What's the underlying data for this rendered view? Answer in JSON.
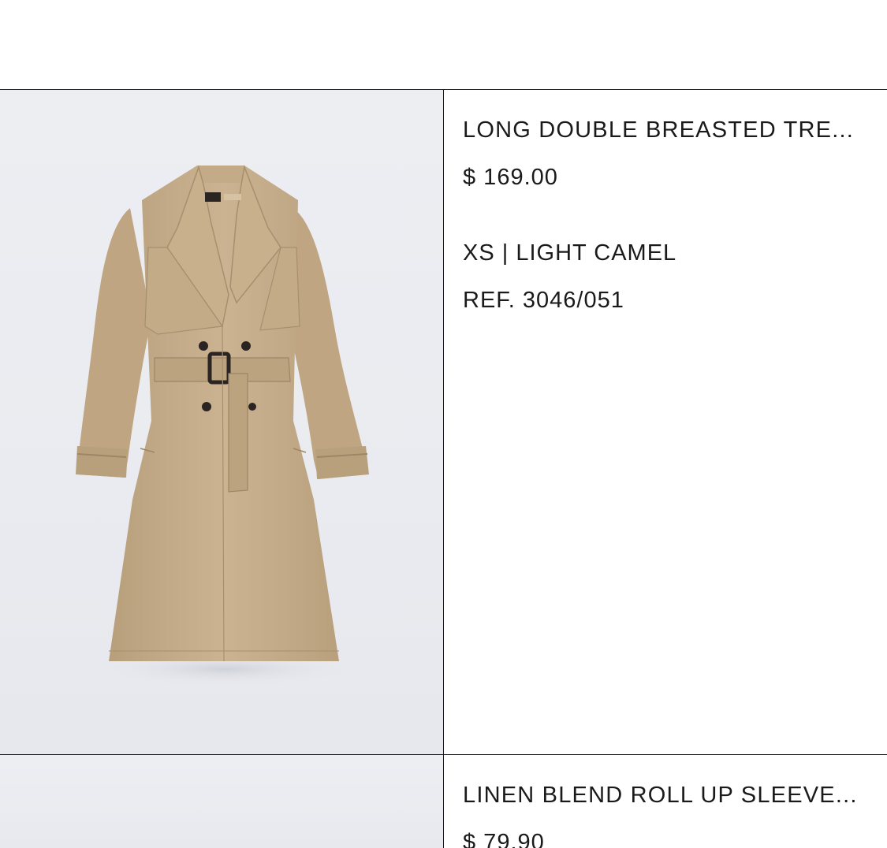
{
  "items": [
    {
      "title": "LONG DOUBLE BREASTED TRE...",
      "price": "$ 169.00",
      "variant": "XS | LIGHT CAMEL",
      "ref": "REF. 3046/051",
      "image_alt": "trench-coat",
      "colors": {
        "coat": "#c9b18e",
        "coat_shadow": "#b39a77",
        "belt_buckle": "#2a2522"
      }
    },
    {
      "title": "LINEN BLEND ROLL UP SLEEVE...",
      "price": "$ 79.90"
    }
  ]
}
